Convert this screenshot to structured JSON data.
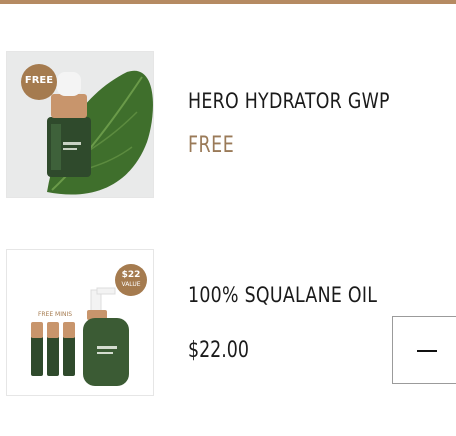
{
  "cart": {
    "items": [
      {
        "name": "HERO HYDRATOR GWP",
        "price": "FREE",
        "badge": "FREE"
      },
      {
        "name": "100% SQUALANE OIL",
        "price": "$22.00",
        "badge_line1": "$22",
        "badge_line2": "VALUE",
        "image_label": "FREE MINIS",
        "quantity_control": "decrease-quantity",
        "icon": "minus-icon"
      }
    ]
  },
  "colors": {
    "accent": "#b58a62",
    "free_text": "#9a7a58",
    "bottle_green": "#2f4a2c",
    "leaf_green": "#3f6f2c"
  }
}
